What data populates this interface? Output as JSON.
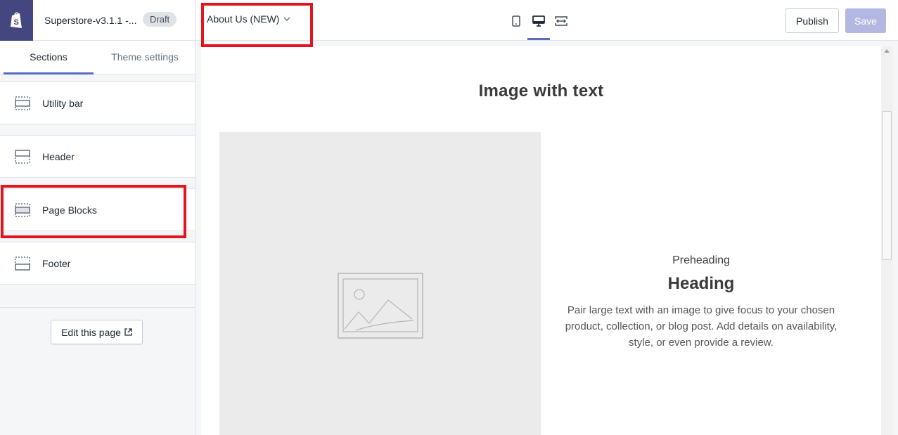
{
  "sidebar": {
    "theme_name": "Superstore-v3.1.1 -...",
    "badge": "Draft",
    "tabs": [
      {
        "label": "Sections",
        "active": true
      },
      {
        "label": "Theme settings",
        "active": false
      }
    ],
    "sections": [
      {
        "label": "Utility bar",
        "icon": "utility-bar-section-icon"
      },
      {
        "label": "Header",
        "icon": "header-section-icon"
      },
      {
        "label": "Page Blocks",
        "icon": "page-blocks-section-icon"
      },
      {
        "label": "Footer",
        "icon": "footer-section-icon"
      }
    ],
    "edit_page_label": "Edit this page"
  },
  "topbar": {
    "page_selector": "About Us (NEW)",
    "view_modes": [
      "mobile",
      "desktop",
      "full-width"
    ],
    "active_view": "desktop",
    "publish_label": "Publish",
    "save_label": "Save"
  },
  "preview": {
    "section_title": "Image with text",
    "preheading": "Preheading",
    "heading": "Heading",
    "body": "Pair large text with an image to give focus to your chosen product, collection, or blog post. Add details on availability, style, or even provide a review."
  },
  "colors": {
    "brand": "#43467f",
    "accent": "#5c6ac4",
    "highlight": "#e3141d",
    "save_disabled": "#b3b8e2"
  }
}
